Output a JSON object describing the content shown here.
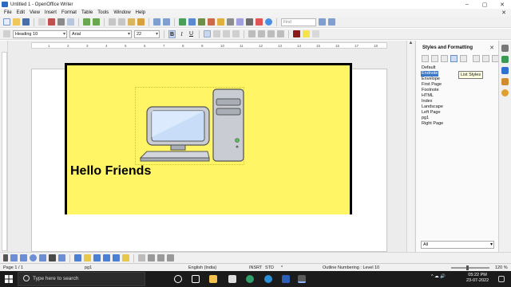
{
  "window": {
    "title": "Untitled 1 - OpenOffice Writer",
    "controls": [
      "–",
      "▢",
      "✕"
    ]
  },
  "menu": [
    "File",
    "Edit",
    "View",
    "Insert",
    "Format",
    "Table",
    "Tools",
    "Window",
    "Help"
  ],
  "menu_close": "✕",
  "toolbar": {
    "find_placeholder": "Find"
  },
  "formatting": {
    "paragraph_style": "Heading 10",
    "font_name": "Arial",
    "font_size": "22",
    "bold": "B",
    "italic": "I",
    "underline": "U"
  },
  "ruler": {
    "ticks": [
      "1",
      "2",
      "3",
      "4",
      "5",
      "6",
      "7",
      "8",
      "9",
      "10",
      "11",
      "12",
      "13",
      "14",
      "15",
      "16",
      "17",
      "18"
    ]
  },
  "document": {
    "heading": "Hello Friends",
    "frame_color": "#fff565"
  },
  "sidebar": {
    "title": "Styles and Formatting",
    "tooltip": "List Styles",
    "styles": [
      "Default",
      "Endnote",
      "Envelope",
      "First Page",
      "Footnote",
      "HTML",
      "Index",
      "Landscape",
      "Left Page",
      "pg1",
      "Right Page"
    ],
    "selected_style": "Endnote",
    "filter": "All"
  },
  "status": {
    "page": "Page 1 / 1",
    "page_style": "pg1",
    "language": "English (India)",
    "insert_mode": "INSRT",
    "selection_mode": "STD",
    "asterisk": "*",
    "outline": "Outline Numbering : Level 10",
    "zoom": "120 %"
  },
  "taskbar": {
    "search_placeholder": "Type here to search",
    "time": "05:22 PM",
    "date": "23-07-2022",
    "tray_text": "^  ☁  🔊"
  }
}
